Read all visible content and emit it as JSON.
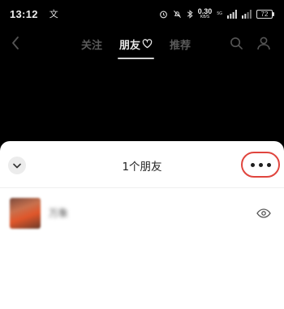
{
  "status_bar": {
    "time": "13:12",
    "app_glyph": "文",
    "net_speed": "0.30",
    "net_unit": "KB/S",
    "sim_label": "5G",
    "battery": "72"
  },
  "nav": {
    "tabs": [
      {
        "label": "关注",
        "active": false
      },
      {
        "label": "朋友",
        "active": true
      },
      {
        "label": "推荐",
        "active": false
      }
    ]
  },
  "sheet": {
    "title": "1个朋友",
    "friends": [
      {
        "name": "万象"
      }
    ]
  },
  "colors": {
    "highlight_ring": "#e0453e",
    "sheet_bg": "#ffffff",
    "page_bg": "#000000"
  }
}
